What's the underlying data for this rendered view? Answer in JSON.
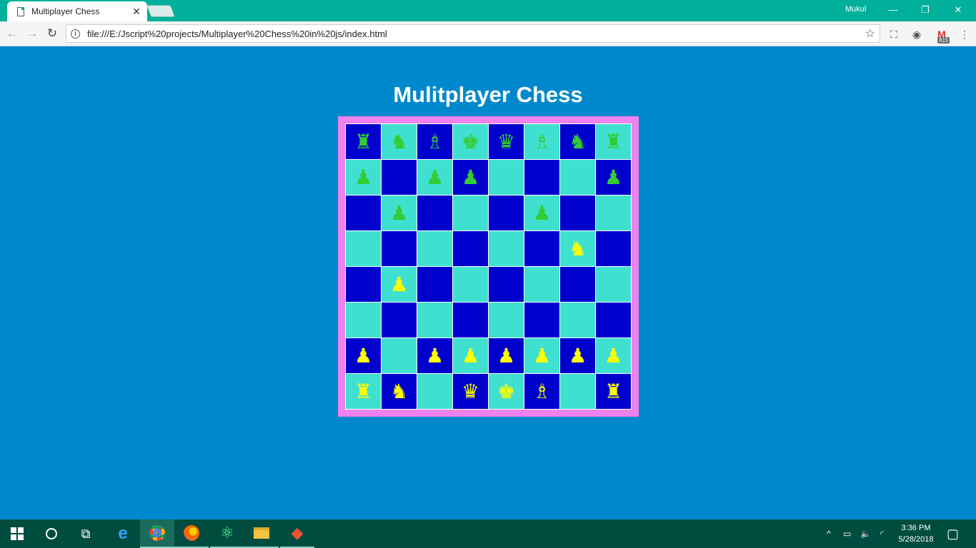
{
  "browser": {
    "tab_title": "Multiplayer Chess",
    "tab_close": "✕",
    "profile_name": "Mukul",
    "minimize": "—",
    "restore": "❐",
    "close": "✕",
    "back": "←",
    "forward": "→",
    "reload": "↻",
    "info": "i",
    "url": "file:///E:/Jscript%20projects/Multiplayer%20Chess%20in%20js/index.html",
    "star": "☆",
    "extensions": [
      "⛶",
      "◉",
      "M",
      "⋮"
    ],
    "gmail_count": "815"
  },
  "page": {
    "title": "Mulitplayer Chess",
    "frame_color": "#ee82ee",
    "dark_square_color": "#0000cd",
    "light_square_color": "#40e0d0",
    "green_piece_color": "#32cd32",
    "yellow_piece_color": "#ffff00"
  },
  "board": {
    "rows": [
      [
        {
          "shade": "dark",
          "piece": "♜",
          "name": "rook",
          "color": "green"
        },
        {
          "shade": "light",
          "piece": "♞",
          "name": "knight",
          "color": "green"
        },
        {
          "shade": "dark",
          "piece": "♗",
          "name": "bishop",
          "color": "green"
        },
        {
          "shade": "light",
          "piece": "♚",
          "name": "king",
          "color": "green"
        },
        {
          "shade": "dark",
          "piece": "♛",
          "name": "queen",
          "color": "green"
        },
        {
          "shade": "light",
          "piece": "♗",
          "name": "bishop",
          "color": "green"
        },
        {
          "shade": "dark",
          "piece": "♞",
          "name": "knight",
          "color": "green"
        },
        {
          "shade": "light",
          "piece": "♜",
          "name": "rook",
          "color": "green"
        }
      ],
      [
        {
          "shade": "light",
          "piece": "♟",
          "name": "pawn",
          "color": "green"
        },
        {
          "shade": "dark",
          "piece": "",
          "name": "",
          "color": ""
        },
        {
          "shade": "light",
          "piece": "♟",
          "name": "pawn",
          "color": "green"
        },
        {
          "shade": "dark",
          "piece": "♟",
          "name": "pawn",
          "color": "green"
        },
        {
          "shade": "light",
          "piece": "",
          "name": "",
          "color": ""
        },
        {
          "shade": "dark",
          "piece": "",
          "name": "",
          "color": ""
        },
        {
          "shade": "light",
          "piece": "",
          "name": "",
          "color": ""
        },
        {
          "shade": "dark",
          "piece": "♟",
          "name": "pawn",
          "color": "green"
        }
      ],
      [
        {
          "shade": "dark",
          "piece": "",
          "name": "",
          "color": ""
        },
        {
          "shade": "light",
          "piece": "♟",
          "name": "pawn",
          "color": "green"
        },
        {
          "shade": "dark",
          "piece": "",
          "name": "",
          "color": ""
        },
        {
          "shade": "light",
          "piece": "",
          "name": "",
          "color": ""
        },
        {
          "shade": "dark",
          "piece": "",
          "name": "",
          "color": ""
        },
        {
          "shade": "light",
          "piece": "♟",
          "name": "pawn",
          "color": "green"
        },
        {
          "shade": "dark",
          "piece": "",
          "name": "",
          "color": ""
        },
        {
          "shade": "light",
          "piece": "",
          "name": "",
          "color": ""
        }
      ],
      [
        {
          "shade": "light",
          "piece": "",
          "name": "",
          "color": ""
        },
        {
          "shade": "dark",
          "piece": "",
          "name": "",
          "color": ""
        },
        {
          "shade": "light",
          "piece": "",
          "name": "",
          "color": ""
        },
        {
          "shade": "dark",
          "piece": "",
          "name": "",
          "color": ""
        },
        {
          "shade": "light",
          "piece": "",
          "name": "",
          "color": ""
        },
        {
          "shade": "dark",
          "piece": "",
          "name": "",
          "color": ""
        },
        {
          "shade": "light",
          "piece": "♞",
          "name": "knight",
          "color": "yellow"
        },
        {
          "shade": "dark",
          "piece": "",
          "name": "",
          "color": ""
        }
      ],
      [
        {
          "shade": "dark",
          "piece": "",
          "name": "",
          "color": ""
        },
        {
          "shade": "light",
          "piece": "♟",
          "name": "pawn",
          "color": "yellow"
        },
        {
          "shade": "dark",
          "piece": "",
          "name": "",
          "color": ""
        },
        {
          "shade": "light",
          "piece": "",
          "name": "",
          "color": ""
        },
        {
          "shade": "dark",
          "piece": "",
          "name": "",
          "color": ""
        },
        {
          "shade": "light",
          "piece": "",
          "name": "",
          "color": ""
        },
        {
          "shade": "dark",
          "piece": "",
          "name": "",
          "color": ""
        },
        {
          "shade": "light",
          "piece": "",
          "name": "",
          "color": ""
        }
      ],
      [
        {
          "shade": "light",
          "piece": "",
          "name": "",
          "color": ""
        },
        {
          "shade": "dark",
          "piece": "",
          "name": "",
          "color": ""
        },
        {
          "shade": "light",
          "piece": "",
          "name": "",
          "color": ""
        },
        {
          "shade": "dark",
          "piece": "",
          "name": "",
          "color": ""
        },
        {
          "shade": "light",
          "piece": "",
          "name": "",
          "color": ""
        },
        {
          "shade": "dark",
          "piece": "",
          "name": "",
          "color": ""
        },
        {
          "shade": "light",
          "piece": "",
          "name": "",
          "color": ""
        },
        {
          "shade": "dark",
          "piece": "",
          "name": "",
          "color": ""
        }
      ],
      [
        {
          "shade": "dark",
          "piece": "♟",
          "name": "pawn",
          "color": "yellow"
        },
        {
          "shade": "light",
          "piece": "",
          "name": "",
          "color": ""
        },
        {
          "shade": "dark",
          "piece": "♟",
          "name": "pawn",
          "color": "yellow"
        },
        {
          "shade": "light",
          "piece": "♟",
          "name": "pawn",
          "color": "yellow"
        },
        {
          "shade": "dark",
          "piece": "♟",
          "name": "pawn",
          "color": "yellow"
        },
        {
          "shade": "light",
          "piece": "♟",
          "name": "pawn",
          "color": "yellow"
        },
        {
          "shade": "dark",
          "piece": "♟",
          "name": "pawn",
          "color": "yellow"
        },
        {
          "shade": "light",
          "piece": "♟",
          "name": "pawn",
          "color": "yellow"
        }
      ],
      [
        {
          "shade": "light",
          "piece": "♜",
          "name": "rook",
          "color": "yellow"
        },
        {
          "shade": "dark",
          "piece": "♞",
          "name": "knight",
          "color": "yellow"
        },
        {
          "shade": "light",
          "piece": "",
          "name": "",
          "color": ""
        },
        {
          "shade": "dark",
          "piece": "♛",
          "name": "queen",
          "color": "yellow"
        },
        {
          "shade": "light",
          "piece": "♚",
          "name": "king",
          "color": "yellow"
        },
        {
          "shade": "dark",
          "piece": "♗",
          "name": "bishop",
          "color": "yellow"
        },
        {
          "shade": "light",
          "piece": "",
          "name": "",
          "color": ""
        },
        {
          "shade": "dark",
          "piece": "♜",
          "name": "rook",
          "color": "yellow"
        }
      ]
    ]
  },
  "taskbar": {
    "apps": [
      {
        "name": "task-view-icon",
        "glyph": "⧉"
      },
      {
        "name": "edge-icon",
        "glyph": "e"
      },
      {
        "name": "chrome-icon",
        "glyph": ""
      },
      {
        "name": "firefox-icon",
        "glyph": ""
      },
      {
        "name": "atom-icon",
        "glyph": "⚛"
      },
      {
        "name": "file-explorer-icon",
        "glyph": ""
      },
      {
        "name": "git-icon",
        "glyph": "◆"
      }
    ],
    "tray": {
      "chevron": "^",
      "battery": "▭",
      "volume": "🔈",
      "wifi": "◜",
      "notifications": "▢"
    },
    "time": "3:36 PM",
    "date": "5/28/2018"
  }
}
